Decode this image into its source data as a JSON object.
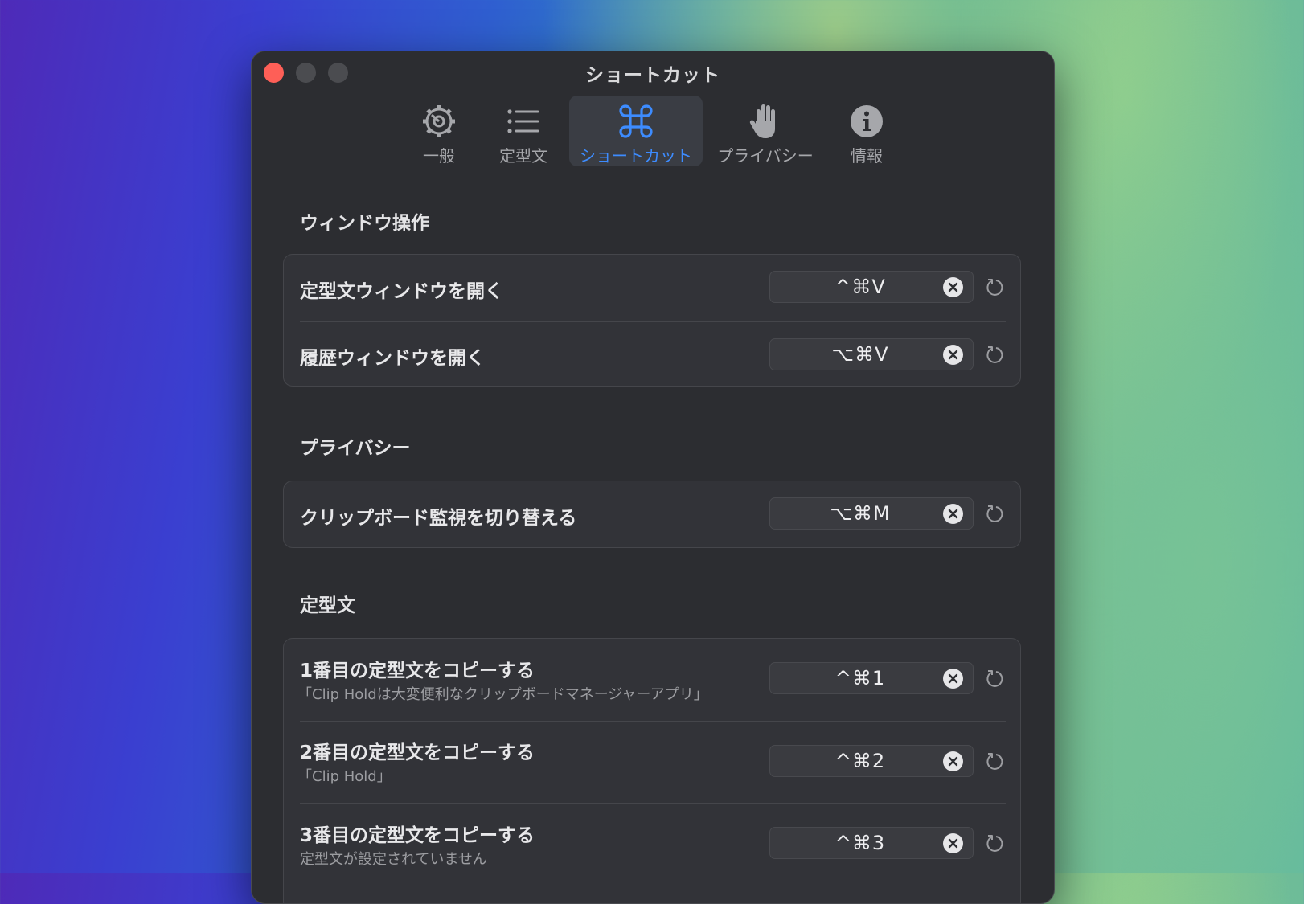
{
  "window": {
    "title": "ショートカット"
  },
  "tabs": [
    {
      "label": "一般",
      "icon": "gear-icon",
      "active": false
    },
    {
      "label": "定型文",
      "icon": "list-icon",
      "active": false
    },
    {
      "label": "ショートカット",
      "icon": "command-icon",
      "active": true
    },
    {
      "label": "プライバシー",
      "icon": "hand-icon",
      "active": false
    },
    {
      "label": "情報",
      "icon": "info-icon",
      "active": false
    }
  ],
  "sections": {
    "window_ops": {
      "title": "ウィンドウ操作",
      "rows": [
        {
          "label": "定型文ウィンドウを開く",
          "shortcut": "^⌘V"
        },
        {
          "label": "履歴ウィンドウを開く",
          "shortcut": "⌥⌘V"
        }
      ]
    },
    "privacy": {
      "title": "プライバシー",
      "rows": [
        {
          "label": "クリップボード監視を切り替える",
          "shortcut": "⌥⌘M"
        }
      ]
    },
    "snippets": {
      "title": "定型文",
      "rows": [
        {
          "label": "1番目の定型文をコピーする",
          "sub": "「Clip Holdは大変便利なクリップボードマネージャーアプリ」",
          "shortcut": "^⌘1"
        },
        {
          "label": "2番目の定型文をコピーする",
          "sub": "「Clip Hold」",
          "shortcut": "^⌘2"
        },
        {
          "label": "3番目の定型文をコピーする",
          "sub": "定型文が設定されていません",
          "shortcut": "^⌘3"
        }
      ]
    }
  },
  "colors": {
    "accent": "#3d8cff",
    "close": "#fe5f57",
    "window_bg": "#2c2d31",
    "group_bg": "#323338"
  }
}
